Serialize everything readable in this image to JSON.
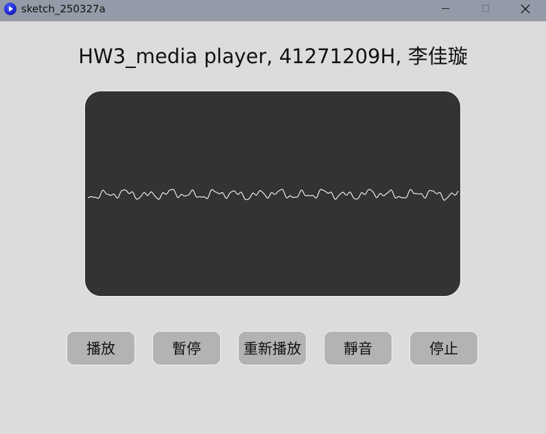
{
  "window": {
    "title": "sketch_250327a",
    "icon": "processing-app-icon"
  },
  "header": {
    "title": "HW3_media player, 41271209H, 李佳璇"
  },
  "visualizer": {
    "background": "#333333",
    "wave_color": "#ffffff",
    "icon": "waveform-icon"
  },
  "controls": {
    "play_label": "播放",
    "pause_label": "暫停",
    "replay_label": "重新播放",
    "mute_label": "靜音",
    "stop_label": "停止",
    "button_color": "#b3b3b3"
  }
}
